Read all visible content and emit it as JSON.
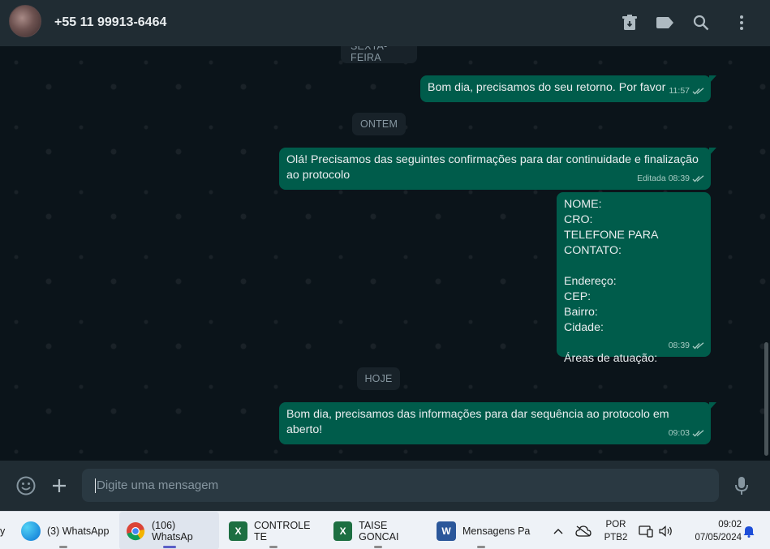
{
  "header": {
    "contact_name": "+55 11 99913-6464",
    "icons": [
      "archive-icon",
      "label-icon",
      "search-icon",
      "menu-icon"
    ]
  },
  "chat": {
    "chips": {
      "friday": "SEXTA-FEIRA",
      "yesterday": "ONTEM",
      "today": "HOJE"
    },
    "messages": {
      "m1": {
        "text": "Bom dia, precisamos do seu retorno. Por favor",
        "time": "11:57",
        "edited": ""
      },
      "m2": {
        "text": "Olá! Precisamos das seguintes confirmações para dar continuidade e finalização\nao protocolo",
        "time": "08:39",
        "edited": "Editada"
      },
      "m3": {
        "text": "NOME:\nCRO:\nTELEFONE PARA CONTATO:\n\nEndereço:\nCEP:\nBairro:\nCidade:\n\nÁreas de atuação:",
        "time": "08:39",
        "edited": ""
      },
      "m4": {
        "text": "Bom dia, precisamos das informações para dar sequência ao protocolo em aberto!",
        "time": "09:03",
        "edited": ""
      }
    }
  },
  "composer": {
    "placeholder": "Digite uma mensagem"
  },
  "taskbar": {
    "items": [
      {
        "label": "(3) WhatsApp",
        "icon": "edge-icon"
      },
      {
        "label": "(106) WhatsAp",
        "icon": "chrome-icon"
      },
      {
        "label": "CONTROLE TE",
        "icon": "excel-icon"
      },
      {
        "label": "TAISE GONCAI",
        "icon": "excel-icon"
      },
      {
        "label": "Mensagens Pa",
        "icon": "word-icon"
      }
    ],
    "leftover": "y",
    "lang": "POR",
    "layout": "PTB2",
    "time": "09:02",
    "date": "07/05/2024"
  },
  "colors": {
    "outgoing_bubble": "#005c4b",
    "chat_bg": "#0b141a",
    "header_bg": "#202c33",
    "input_bg": "#2a3942"
  }
}
